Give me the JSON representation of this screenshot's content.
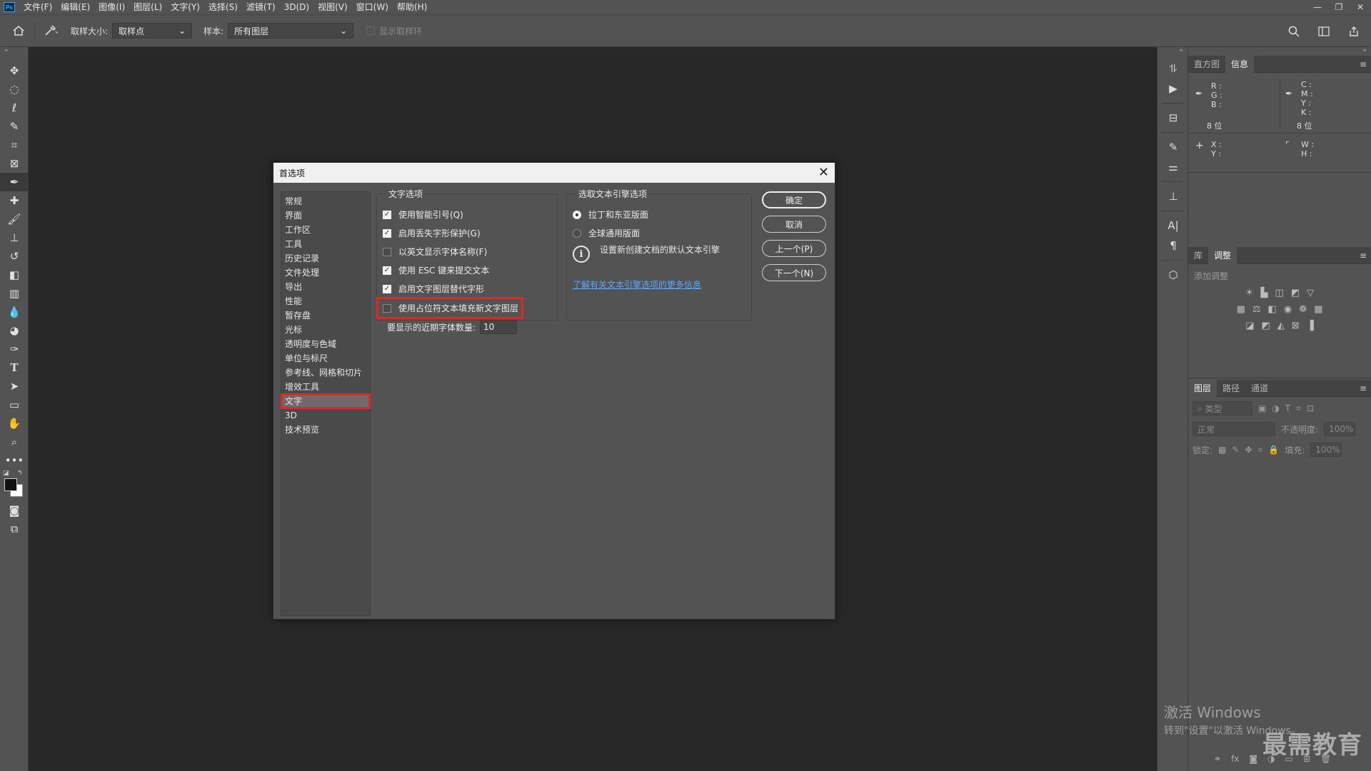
{
  "menubar": {
    "logo": "Ps",
    "items": [
      "文件(F)",
      "编辑(E)",
      "图像(I)",
      "图层(L)",
      "文字(Y)",
      "选择(S)",
      "滤镜(T)",
      "3D(D)",
      "视图(V)",
      "窗口(W)",
      "帮助(H)"
    ]
  },
  "window_controls": {
    "minimize": "—",
    "restore": "❐",
    "close": "✕"
  },
  "options": {
    "sample_size_label": "取样大小:",
    "sample_size_value": "取样点",
    "sample_label": "样本:",
    "sample_value": "所有图层",
    "show_ring_label": "显示取样环"
  },
  "panels": {
    "top_tabs": [
      "直方图",
      "信息"
    ],
    "info": {
      "rgb_labels": "R :\nG :\nB :",
      "cmyk_labels": "C :\nM :\nY :\nK :",
      "bits_left": "8 位",
      "bits_right": "8 位",
      "xy_labels": "X :\nY :",
      "wh_labels": "W :\nH :"
    },
    "mid_tabs": [
      "库",
      "调整"
    ],
    "adjustments_title": "添加调整",
    "layers_tabs": [
      "图层",
      "路径",
      "通道"
    ],
    "layers": {
      "filter_placeholder": "类型",
      "blend_mode": "正常",
      "opacity_label": "不透明度:",
      "opacity_value": "100%",
      "lock_label": "锁定:",
      "fill_label": "填充:",
      "fill_value": "100%"
    }
  },
  "dialog": {
    "title": "首选项",
    "categories": [
      "常规",
      "界面",
      "工作区",
      "工具",
      "历史记录",
      "文件处理",
      "导出",
      "性能",
      "暂存盘",
      "光标",
      "透明度与色域",
      "单位与标尺",
      "参考线、网格和切片",
      "增效工具",
      "文字",
      "3D",
      "技术预览"
    ],
    "selected_category": "文字",
    "type_options": {
      "legend": "文字选项",
      "items": [
        {
          "label": "使用智能引号(Q)",
          "checked": true
        },
        {
          "label": "启用丢失字形保护(G)",
          "checked": true
        },
        {
          "label": "以英文显示字体名称(F)",
          "checked": false
        },
        {
          "label": "使用 ESC 键来提交文本",
          "checked": true
        },
        {
          "label": "启用文字图层替代字形",
          "checked": true
        },
        {
          "label": "使用占位符文本填充新文字图层",
          "checked": false
        }
      ],
      "recent_fonts_label": "要显示的近期字体数量:",
      "recent_fonts_value": "10"
    },
    "engine_options": {
      "legend": "选取文本引擎选项",
      "options": [
        {
          "label": "拉丁和东亚版面",
          "selected": true
        },
        {
          "label": "全球通用版面",
          "selected": false
        }
      ],
      "info_text": "设置新创建文档的默认文本引擎",
      "link": "了解有关文本引擎选项的更多信息"
    },
    "buttons": {
      "ok": "确定",
      "cancel": "取消",
      "prev": "上一个(P)",
      "next": "下一个(N)"
    }
  },
  "watermark": {
    "line1": "激活 Windows",
    "line2": "转到\"设置\"以激活 Windows。",
    "brand": "最需教育"
  },
  "colors": {
    "highlight": "#e0282a",
    "link": "#5aa8ff",
    "panel": "#535353",
    "canvas": "#282828"
  }
}
